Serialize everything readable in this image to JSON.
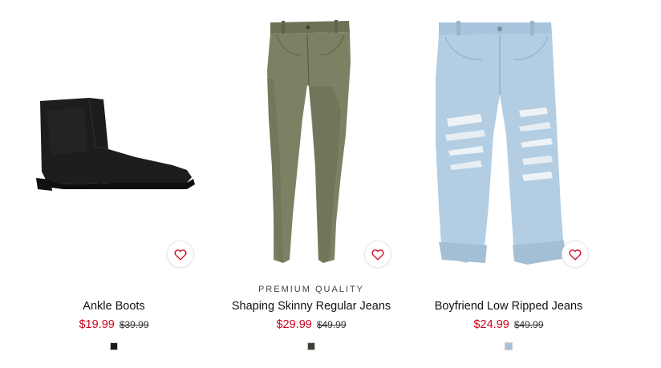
{
  "products": [
    {
      "name": "Ankle Boots",
      "badge": "",
      "sale_price": "$19.99",
      "original_price": "$39.99",
      "swatch_color": "#1a1a1a",
      "image_icon": "ankle-boot-image",
      "favorite_icon": "heart-outline-icon"
    },
    {
      "name": "Shaping Skinny Regular Jeans",
      "badge": "PREMIUM QUALITY",
      "sale_price": "$29.99",
      "original_price": "$49.99",
      "swatch_color": "#3c3f36",
      "image_icon": "khaki-skinny-jeans-image",
      "favorite_icon": "heart-outline-icon"
    },
    {
      "name": "Boyfriend Low Ripped Jeans",
      "badge": "",
      "sale_price": "$24.99",
      "original_price": "$49.99",
      "swatch_color": "#a9c0d8",
      "image_icon": "light-blue-ripped-jeans-image",
      "favorite_icon": "heart-outline-icon"
    }
  ],
  "colors": {
    "sale": "#d0021b",
    "favorite_icon": "#d0021b"
  }
}
